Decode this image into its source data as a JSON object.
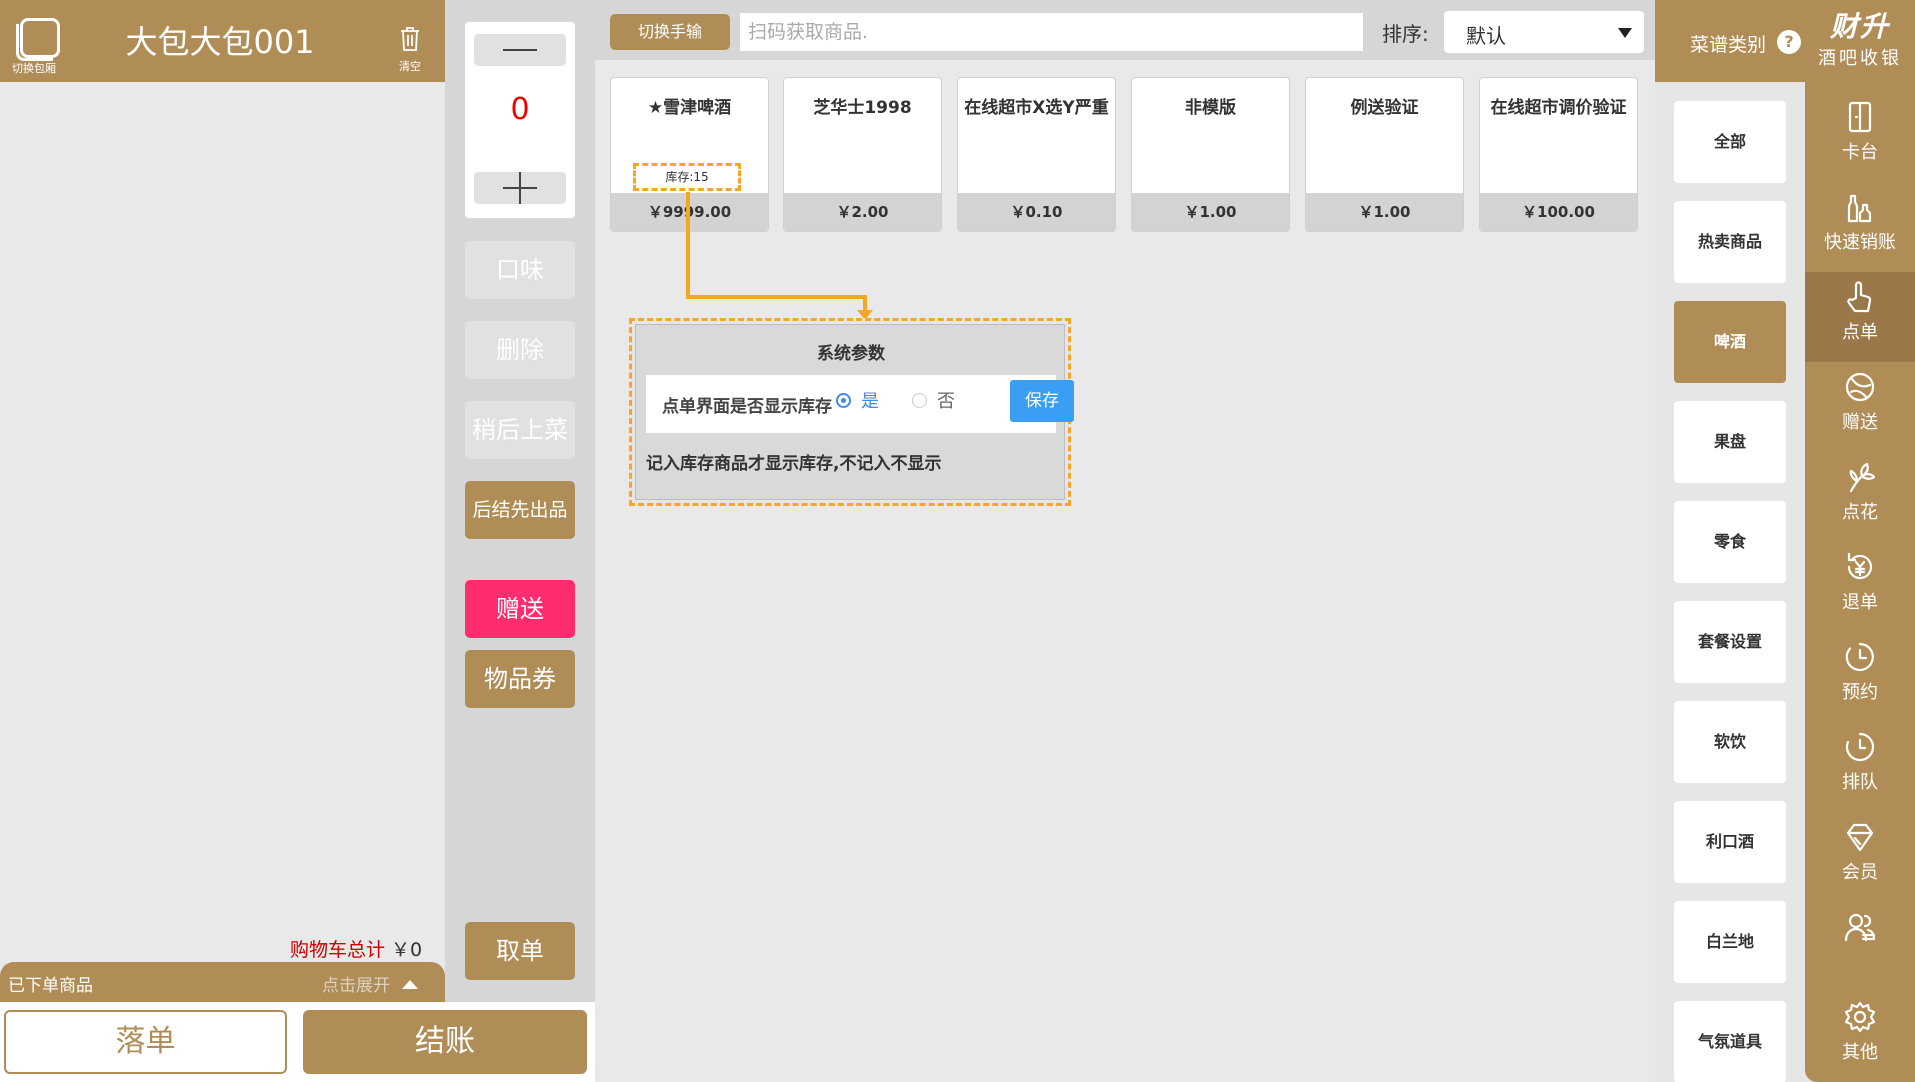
{
  "cart": {
    "switch_room_label": "切换包厢",
    "room_title": "大包大包001",
    "clear_label": "清空",
    "total_label": "购物车总计",
    "total_amount": "￥0",
    "ordered_label": "已下单商品",
    "expand_label": "点击展开",
    "place_order_label": "落单",
    "checkout_label": "结账"
  },
  "actions": {
    "quantity": "0",
    "flavor": "口味",
    "delete": "删除",
    "serve_later": "稍后上菜",
    "settle_first": "后结先出品",
    "gift": "赠送",
    "voucher": "物品券",
    "fetch_order": "取单"
  },
  "topbar": {
    "switch_input_label": "切换手输",
    "scan_placeholder": "扫码获取商品.",
    "sort_label": "排序:",
    "sort_value": "默认"
  },
  "products": [
    {
      "name": "★雪津啤酒",
      "price": "￥9999.00",
      "stock": "库存:15"
    },
    {
      "name": "芝华士1998",
      "price": "￥2.00"
    },
    {
      "name": "在线超市X选Y严重",
      "price": "￥0.10"
    },
    {
      "name": "非模版",
      "price": "￥1.00"
    },
    {
      "name": "例送验证",
      "price": "￥1.00"
    },
    {
      "name": "在线超市调价验证",
      "price": "￥100.00"
    }
  ],
  "sys_params": {
    "title": "系统参数",
    "row_label": "点单界面是否显示库存",
    "yes_label": "是",
    "no_label": "否",
    "selected": "是",
    "save_label": "保存",
    "note": "记入库存商品才显示库存,不记入不显示",
    "highlight_color": "#f5a623"
  },
  "categories": {
    "title": "菜谱类别",
    "help_icon": "?",
    "items": [
      "全部",
      "热卖商品",
      "啤酒",
      "果盘",
      "零食",
      "套餐设置",
      "软饮",
      "利口酒",
      "白兰地",
      "气氛道具"
    ],
    "active": "啤酒"
  },
  "nav": {
    "brand_logo": "财升",
    "brand_sub": "酒吧收银",
    "items": [
      {
        "label": "卡台",
        "icon": "door-icon"
      },
      {
        "label": "快速销账",
        "icon": "bottles-icon"
      },
      {
        "label": "点单",
        "icon": "hand-pointer-icon"
      },
      {
        "label": "赠送",
        "icon": "gift-icon"
      },
      {
        "label": "点花",
        "icon": "flower-icon"
      },
      {
        "label": "退单",
        "icon": "refund-icon"
      },
      {
        "label": "预约",
        "icon": "clock-icon"
      },
      {
        "label": "排队",
        "icon": "queue-clock-icon"
      },
      {
        "label": "会员",
        "icon": "diamond-icon"
      },
      {
        "label": "",
        "icon": "users-icon"
      },
      {
        "label": "其他",
        "icon": "gear-icon"
      }
    ],
    "active": "点单"
  },
  "colors": {
    "brand_gold": "#b08d57",
    "gift_pink": "#ff2d6e",
    "qty_red": "#ee0000",
    "save_blue": "#3a9ff2"
  }
}
